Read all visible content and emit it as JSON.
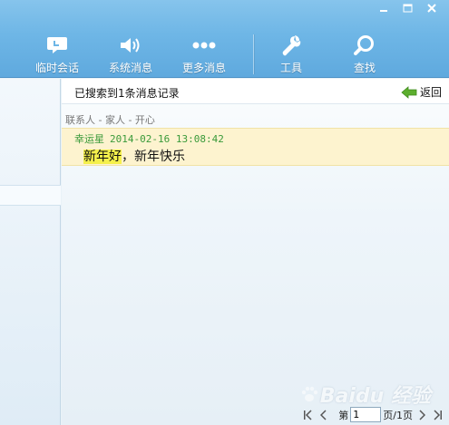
{
  "toolbar": {
    "items": [
      {
        "label": "临时会话",
        "icon": "chat-bubble-icon"
      },
      {
        "label": "系统消息",
        "icon": "speaker-icon"
      },
      {
        "label": "更多消息",
        "icon": "more-dots-icon"
      },
      {
        "label": "工具",
        "icon": "wrench-icon"
      },
      {
        "label": "查找",
        "icon": "magnifier-icon"
      }
    ],
    "window_controls": [
      "minimize",
      "maximize",
      "close"
    ]
  },
  "search": {
    "result_text": "已搜索到1条消息记录",
    "back_label": "返回"
  },
  "breadcrumb": "联系人 - 家人 - 开心",
  "messages": [
    {
      "sender": "幸运星",
      "timestamp": "2014-02-16 13:08:42",
      "text_highlight": "新年好",
      "text_rest": "，新年快乐"
    }
  ],
  "pager": {
    "prefix": "第",
    "current": "1",
    "suffix": "页/1页"
  },
  "watermark": "Baidu 经验",
  "colors": {
    "toolbar_top": "#86c4ec",
    "toolbar_bottom": "#5fa9de",
    "message_bg": "#fdf3cf",
    "highlight": "#f5f04c",
    "timestamp": "#3a9a3a"
  }
}
